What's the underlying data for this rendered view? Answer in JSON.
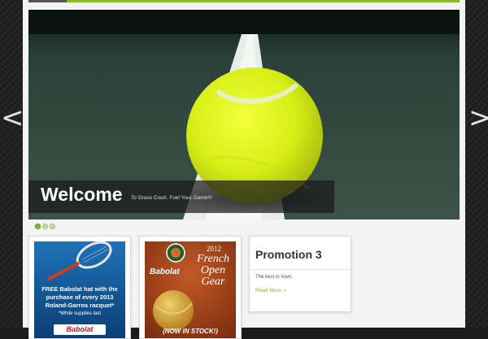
{
  "slider": {
    "caption_title": "Welcome",
    "caption_subtitle": "To Grass Court. Fuel Your Game!!!",
    "dots": 3,
    "active_dot": 0,
    "prev_label": "<",
    "next_label": ">"
  },
  "promos": [
    {
      "id": "promo-1",
      "ad_line1": "FREE Babolat hat with the",
      "ad_line2": "purchase of every 2013",
      "ad_line3": "Roland-Garros racquet*",
      "ad_footnote": "*While supplies last",
      "brand": "Babolat"
    },
    {
      "id": "promo-2",
      "year": "2012",
      "headline1": "French",
      "headline2": "Open",
      "headline3": "Gear",
      "brand": "Babolat",
      "stock_note": "(NOW IN STOCK!)"
    },
    {
      "id": "promo-3",
      "title": "Promotion 3",
      "text": "The best in town.",
      "link": "Read More »"
    }
  ],
  "colors": {
    "accent": "#8ab82c",
    "page_bg": "#f3f3f3",
    "outer_bg": "#222222"
  }
}
